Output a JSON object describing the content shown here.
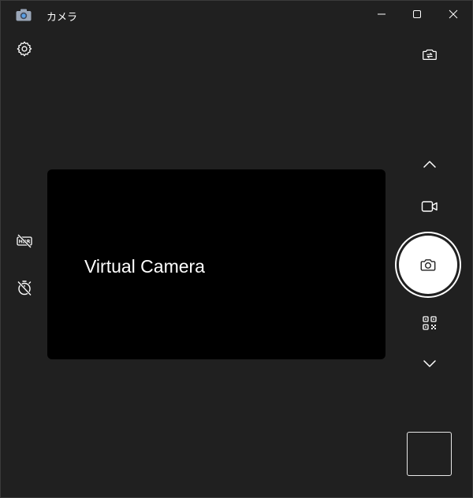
{
  "window": {
    "title": "カメラ"
  },
  "preview": {
    "label": "Virtual Camera"
  },
  "icons": {
    "app": "camera-app-icon",
    "minimize": "minimize-icon",
    "maximize": "maximize-icon",
    "close": "close-icon",
    "settings": "gear-icon",
    "switch_camera": "switch-camera-icon",
    "hdr": "hdr-off-icon",
    "timer": "timer-off-icon",
    "mode_up": "chevron-up-icon",
    "video_mode": "video-camera-icon",
    "photo_shutter": "camera-icon",
    "qr_mode": "qr-code-icon",
    "mode_down": "chevron-down-icon"
  },
  "colors": {
    "background": "#202020",
    "preview": "#000000",
    "foreground": "#ffffff"
  }
}
